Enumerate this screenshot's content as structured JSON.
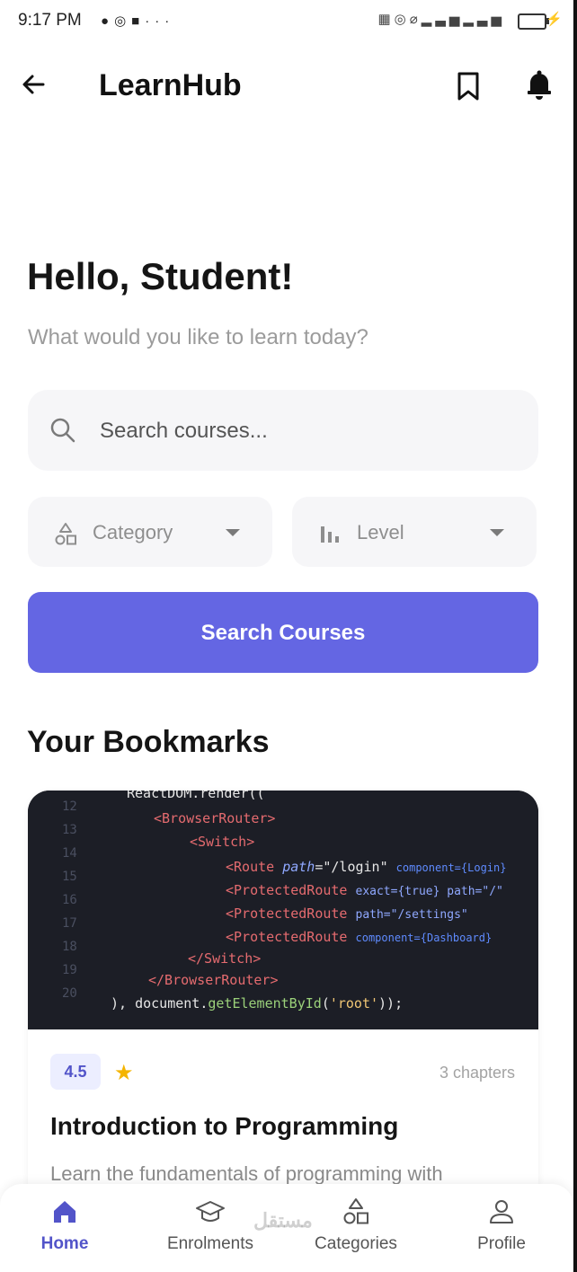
{
  "status_bar": {
    "time": "9:17 PM",
    "left_icons": [
      "message-icon",
      "whatsapp-icon",
      "video-icon",
      "more-icon"
    ],
    "right_icons": [
      "data-icon",
      "hotspot-icon",
      "mute-icon",
      "signal-icon",
      "signal-icon",
      "battery-icon",
      "charging-icon"
    ]
  },
  "app_bar": {
    "title": "LearnHub",
    "icons": [
      "back-arrow-icon",
      "bookmark-icon",
      "bell-icon"
    ]
  },
  "greeting": {
    "title": "Hello, Student!",
    "subtitle": "What would you like to learn today?"
  },
  "search": {
    "placeholder": "Search courses...",
    "value": ""
  },
  "filters": {
    "category_label": "Category",
    "level_label": "Level"
  },
  "search_button": {
    "label": "Search Courses"
  },
  "bookmarks": {
    "section_title": "Your Bookmarks",
    "courses": [
      {
        "rating": "4.5",
        "chapters": "3 chapters",
        "title": "Introduction to Programming",
        "description": "Learn the fundamentals of programming with"
      }
    ]
  },
  "bottom_nav": {
    "items": [
      {
        "label": "Home",
        "icon": "home-icon",
        "active": true
      },
      {
        "label": "Enrolments",
        "icon": "graduation-cap-icon",
        "active": false
      },
      {
        "label": "Categories",
        "icon": "shapes-icon",
        "active": false
      },
      {
        "label": "Profile",
        "icon": "person-icon",
        "active": false
      }
    ]
  },
  "watermark": {
    "text": "مستقل"
  },
  "colors": {
    "accent": "#6466e3",
    "text_primary": "#151515",
    "text_muted": "#9b9b9b",
    "field_bg": "#f6f6f8",
    "star": "#f4b400"
  }
}
